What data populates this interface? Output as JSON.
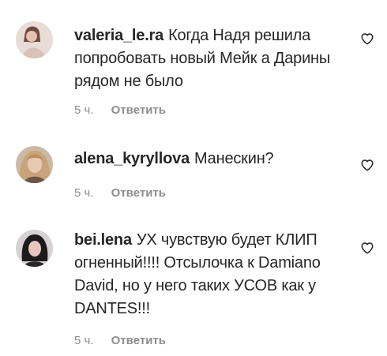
{
  "comments": [
    {
      "username": "valeria_le.ra",
      "text": "Когда Надя решила попробовать новый Мейк а Дарины рядом не было",
      "time": "5 ч.",
      "reply_label": "Ответить",
      "avatar_icon": "user-avatar-light"
    },
    {
      "username": "alena_kyryllova",
      "text": "Манескин?",
      "time": "5 ч.",
      "reply_label": "Ответить",
      "avatar_icon": "user-avatar-blonde"
    },
    {
      "username": "bei.lena",
      "text": "УХ чувствую будет КЛИП огненный!!!! Отсылочка к Damiano David, но у него таких УСОВ как у DANTES!!!",
      "time": "5 ч.",
      "reply_label": "Ответить",
      "avatar_icon": "user-avatar-dark"
    }
  ],
  "colors": {
    "text": "#262626",
    "secondary": "#8e8e8e",
    "background": "#ffffff"
  },
  "icons": {
    "like": "heart-outline-icon"
  }
}
